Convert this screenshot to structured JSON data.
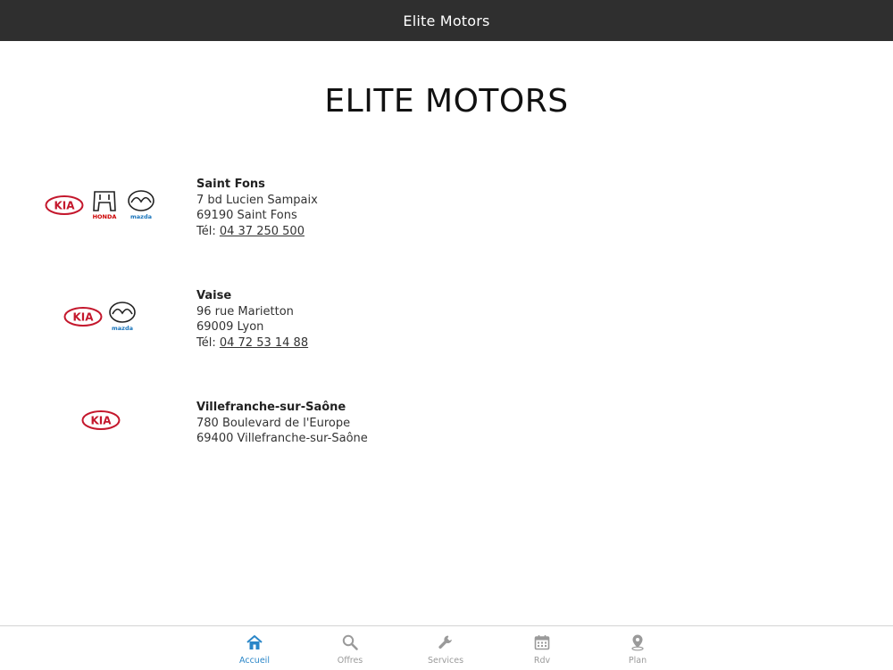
{
  "header": {
    "title": "Elite Motors"
  },
  "brand": {
    "title": "ELITE MOTORS"
  },
  "dealers": [
    {
      "name": "Saint Fons",
      "street": "7 bd Lucien Sampaix",
      "city": "69190 Saint Fons",
      "phone_prefix": "Tél: ",
      "phone": "04 37 250 500",
      "brands": [
        "Kia",
        "Honda",
        "Mazda"
      ]
    },
    {
      "name": "Vaise",
      "street": "96 rue Marietton",
      "city": "69009 Lyon",
      "phone_prefix": "Tél: ",
      "phone": "04 72 53 14 88",
      "brands": [
        "Kia",
        "Mazda"
      ]
    },
    {
      "name": "Villefranche-sur-Saône",
      "street": "780 Boulevard de l'Europe",
      "city": "69400 Villefranche-sur-Saône",
      "brands": [
        "Kia"
      ]
    }
  ],
  "logo_text": {
    "kia": "KIA",
    "honda": "HONDA",
    "mazda": "mazda"
  },
  "tabs": [
    {
      "label": "Accueil",
      "icon": "home-icon",
      "active": true
    },
    {
      "label": "Offres",
      "icon": "search-icon",
      "active": false
    },
    {
      "label": "Services",
      "icon": "wrench-icon",
      "active": false
    },
    {
      "label": "Rdv",
      "icon": "calendar-icon",
      "active": false
    },
    {
      "label": "Plan",
      "icon": "map-pin-icon",
      "active": false
    }
  ],
  "colors": {
    "header_bg": "#2f2f2f",
    "active_tab": "#2a86c8",
    "inactive_tab": "#9a9a9a",
    "kia_red": "#c4172c",
    "honda_red": "#cc0000",
    "mazda_blue": "#1a75bb"
  }
}
